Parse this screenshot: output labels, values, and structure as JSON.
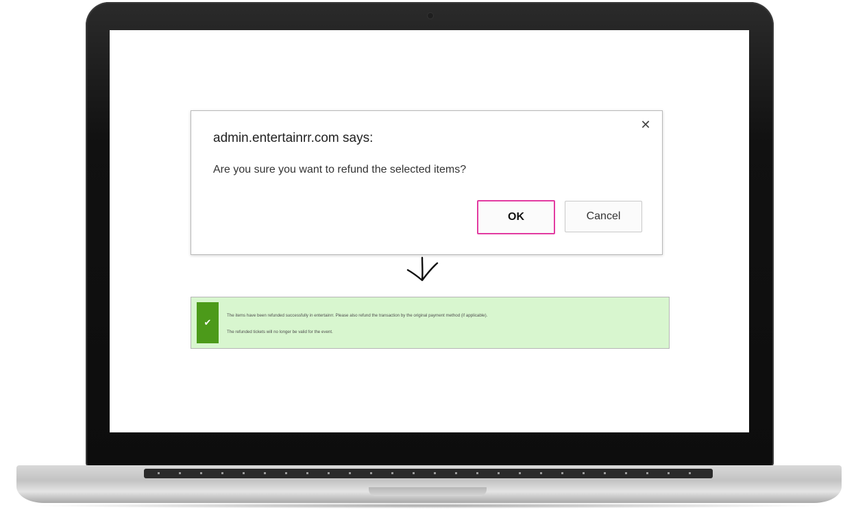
{
  "dialog": {
    "title": "admin.entertainrr.com says:",
    "message": "Are you sure you want to refund the selected items?",
    "close_icon": "close-icon",
    "ok_label": "OK",
    "cancel_label": "Cancel",
    "ok_highlight_color": "#e23aa0"
  },
  "arrow_icon": "arrow-down-icon",
  "notice": {
    "icon": "checkmark-icon",
    "line1": "The items have been refunded successfully in entertainrr. Please also refund the transaction by the original payment method (if applicable).",
    "line2": "The refunded tickets will no longer be valid for the event.",
    "background_color": "#d8f6cf",
    "icon_color": "#4c9a1a"
  }
}
